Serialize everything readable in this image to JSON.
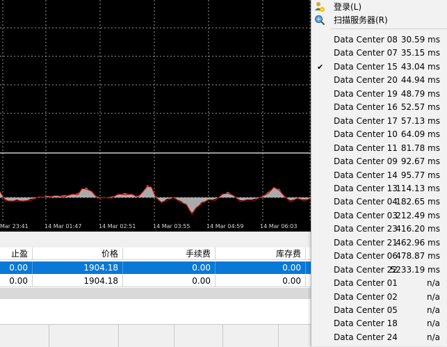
{
  "chart": {
    "time_labels": [
      "Mar 23:41",
      "14 Mar 01:47",
      "14 Mar 02:51",
      "14 Mar 03:55",
      "14 Mar 04:59",
      "14 Mar 06:03"
    ],
    "colors": {
      "background": "#000000",
      "grid": "#9a9a9a",
      "main_line": "#cc0000",
      "signal_fill": "#c8c8c8"
    }
  },
  "table": {
    "headers": [
      "止盈",
      "价格",
      "手续费",
      "库存费"
    ],
    "rows": [
      {
        "selected": true,
        "cells": [
          "0.00",
          "1904.18",
          "0.00",
          "0.00"
        ]
      },
      {
        "selected": false,
        "cells": [
          "0.00",
          "1904.18",
          "0.00",
          "0.00"
        ]
      }
    ]
  },
  "menu": {
    "actions": [
      {
        "label": "登录(L)",
        "icon": "user-login-icon"
      },
      {
        "label": "扫描服务器(R)",
        "icon": "scan-servers-icon"
      }
    ],
    "servers": [
      {
        "name": "Data Center 08",
        "ping": "30.59 ms",
        "checked": false
      },
      {
        "name": "Data Center 07",
        "ping": "35.15 ms",
        "checked": false
      },
      {
        "name": "Data Center 15",
        "ping": "43.04 ms",
        "checked": true
      },
      {
        "name": "Data Center 20",
        "ping": "44.94 ms",
        "checked": false
      },
      {
        "name": "Data Center 19",
        "ping": "48.79 ms",
        "checked": false
      },
      {
        "name": "Data Center 16",
        "ping": "52.57 ms",
        "checked": false
      },
      {
        "name": "Data Center 17",
        "ping": "57.13 ms",
        "checked": false
      },
      {
        "name": "Data Center 10",
        "ping": "64.09 ms",
        "checked": false
      },
      {
        "name": "Data Center 11",
        "ping": "81.78 ms",
        "checked": false
      },
      {
        "name": "Data Center 09",
        "ping": "92.67 ms",
        "checked": false
      },
      {
        "name": "Data Center 14",
        "ping": "95.77 ms",
        "checked": false
      },
      {
        "name": "Data Center 13",
        "ping": "114.13 ms",
        "checked": false
      },
      {
        "name": "Data Center 04",
        "ping": "182.65 ms",
        "checked": false
      },
      {
        "name": "Data Center 03",
        "ping": "212.49 ms",
        "checked": false
      },
      {
        "name": "Data Center 23",
        "ping": "416.20 ms",
        "checked": false
      },
      {
        "name": "Data Center 21",
        "ping": "462.96 ms",
        "checked": false
      },
      {
        "name": "Data Center 06",
        "ping": "478.87 ms",
        "checked": false
      },
      {
        "name": "Data Center 22",
        "ping": "5233.19 ms",
        "checked": false
      },
      {
        "name": "Data Center 01",
        "ping": "n/a",
        "checked": false
      },
      {
        "name": "Data Center 02",
        "ping": "n/a",
        "checked": false
      },
      {
        "name": "Data Center 05",
        "ping": "n/a",
        "checked": false
      },
      {
        "name": "Data Center 18",
        "ping": "n/a",
        "checked": false
      },
      {
        "name": "Data Center 24",
        "ping": "n/a",
        "checked": false
      }
    ],
    "check_glyph": "✔"
  }
}
